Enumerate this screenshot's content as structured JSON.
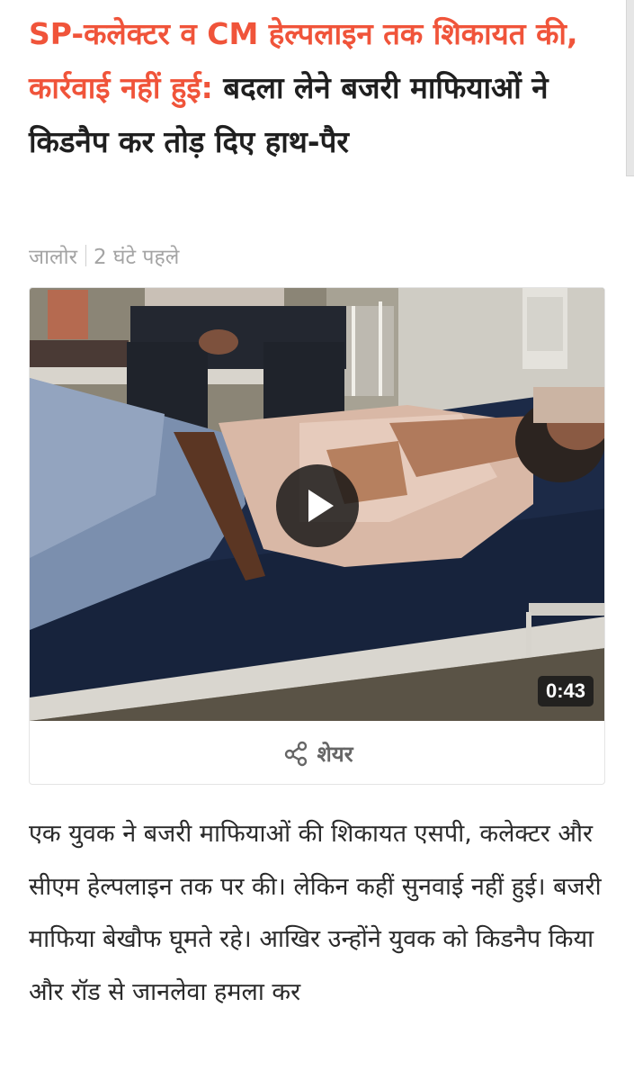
{
  "headline": {
    "highlight": "SP-कलेक्टर व CM हेल्पलाइन तक शिकायत की, कार्रवाई नहीं हुई:",
    "rest": " बदला लेने बजरी माफियाओं ने किडनैप कर तोड़ दिए हाथ-पैर"
  },
  "meta": {
    "location": "जालोर",
    "time": "2 घंटे पहले"
  },
  "video": {
    "duration": "0:43",
    "play_icon": "play-icon"
  },
  "share": {
    "label": "शेयर",
    "icon": "share-icon"
  },
  "article": {
    "text": "एक युवक ने बजरी माफियाओं की शिकायत एसपी, कलेक्टर और सीएम हेल्पलाइन तक पर की। लेकिन कहीं सुनवाई नहीं हुई। बजरी माफिया बेखौफ घूमते रहे। आखिर उन्होंने युवक को किडनैप किया और रॉड से जानलेवा हमला कर"
  },
  "colors": {
    "accent": "#f0543a",
    "text": "#1f1f1f",
    "meta": "#a4a4a4"
  }
}
